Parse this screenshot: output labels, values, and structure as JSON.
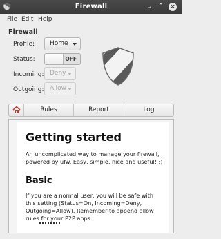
{
  "window": {
    "title": "Firewall"
  },
  "menu": {
    "items": [
      "File",
      "Edit",
      "Help"
    ]
  },
  "firewall": {
    "section_title": "Firewall",
    "profile_label": "Profile:",
    "profile_value": "Home",
    "status_label": "Status:",
    "status_value": "OFF",
    "incoming_label": "Incoming:",
    "incoming_value": "Deny",
    "outgoing_label": "Outgoing:",
    "outgoing_value": "Allow"
  },
  "tabs": {
    "home_icon": "home-icon",
    "items": [
      "Rules",
      "Report",
      "Log"
    ]
  },
  "doc": {
    "heading": "Getting started",
    "intro": "An uncomplicated way to manage your firewall, powered by ufw. Easy, simple, nice and useful! :)",
    "subheading": "Basic",
    "body": "If you are a normal user, you will be safe with this setting (Status=On, Incoming=Deny, Outgoing=Allow). Remember to append allow rules for your P2P apps:"
  },
  "colors": {
    "titlebar": "#3f3f3f",
    "accent_home": "#c43c2e",
    "shield_light": "#f2f2f2",
    "shield_dark": "#555555"
  }
}
